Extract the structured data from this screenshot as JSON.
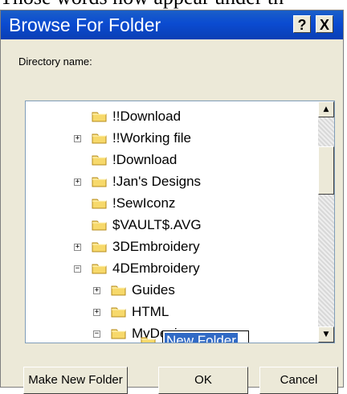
{
  "page": {
    "overlay_text": "Those words now appear under th"
  },
  "window": {
    "title": "Browse For Folder",
    "help_button": "?",
    "close_button": "X"
  },
  "dialog": {
    "directory_label": "Directory name:"
  },
  "tree": {
    "items": [
      {
        "label": "!!Download",
        "expander": ""
      },
      {
        "label": "!!Working file",
        "expander": "+"
      },
      {
        "label": "!Download",
        "expander": ""
      },
      {
        "label": "!Jan's Designs",
        "expander": "+"
      },
      {
        "label": "!SewIconz",
        "expander": ""
      },
      {
        "label": "$VAULT$.AVG",
        "expander": ""
      },
      {
        "label": "3DEmbroidery",
        "expander": "+"
      },
      {
        "label": "4DEmbroidery",
        "expander": "−"
      },
      {
        "label": "Guides",
        "expander": "+"
      },
      {
        "label": "HTML",
        "expander": "+"
      },
      {
        "label": "MyDesigns",
        "expander": "−"
      }
    ],
    "new_folder_edit": "New Folder"
  },
  "buttons": {
    "make_new_folder": "Make New Folder",
    "ok": "OK",
    "cancel": "Cancel"
  }
}
